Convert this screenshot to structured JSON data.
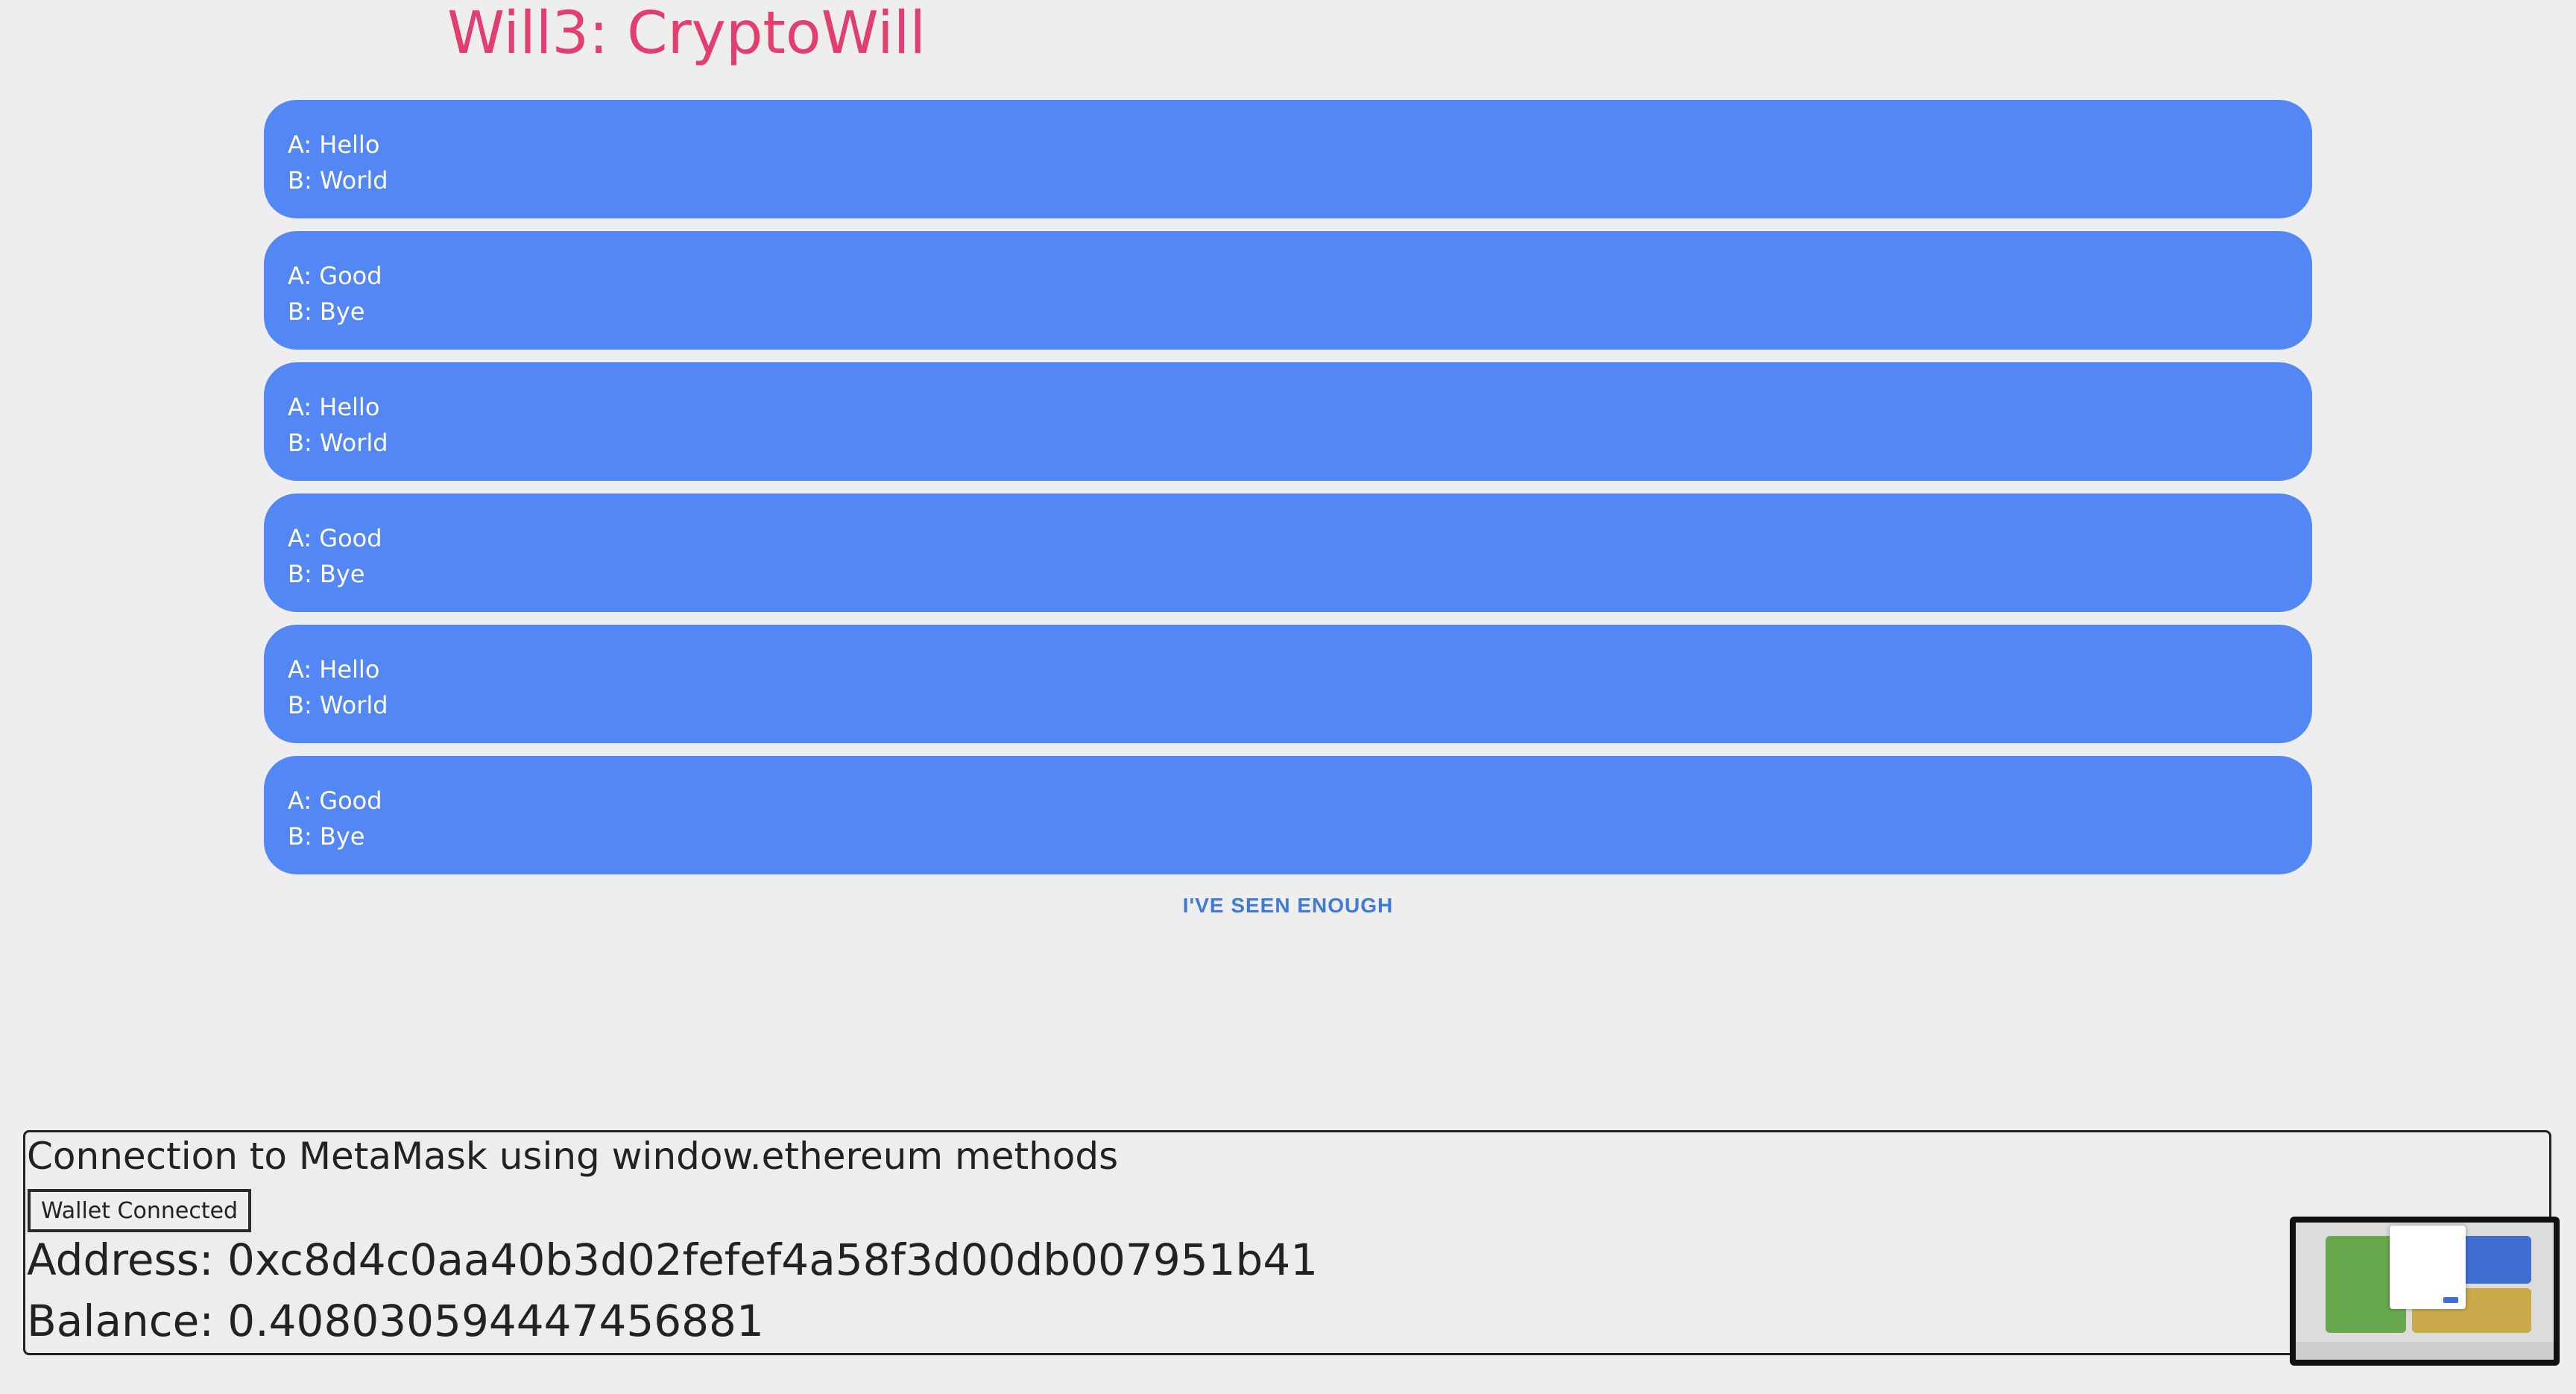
{
  "header": {
    "title": "Will3: CryptoWill"
  },
  "cards": [
    {
      "line_a": "A: Hello",
      "line_b": "B: World"
    },
    {
      "line_a": "A: Good",
      "line_b": "B: Bye"
    },
    {
      "line_a": "A: Hello",
      "line_b": "B: World"
    },
    {
      "line_a": "A: Good",
      "line_b": "B: Bye"
    },
    {
      "line_a": "A: Hello",
      "line_b": "B: World"
    },
    {
      "line_a": "A: Good",
      "line_b": "B: Bye"
    }
  ],
  "actions": {
    "seen_enough_label": "I'VE SEEN ENOUGH"
  },
  "wallet": {
    "heading": "Connection to MetaMask using window.ethereum methods",
    "button_label": "Wallet Connected",
    "address_line": "Address: 0xc8d4c0aa40b3d02fefef4a58f3d00db007951b41",
    "balance_line": "Balance: 0.408030594447456881"
  },
  "colors": {
    "title": "#e23e6f",
    "card": "#5387f6",
    "link": "#3f7ad8",
    "background": "#eeeeee"
  }
}
